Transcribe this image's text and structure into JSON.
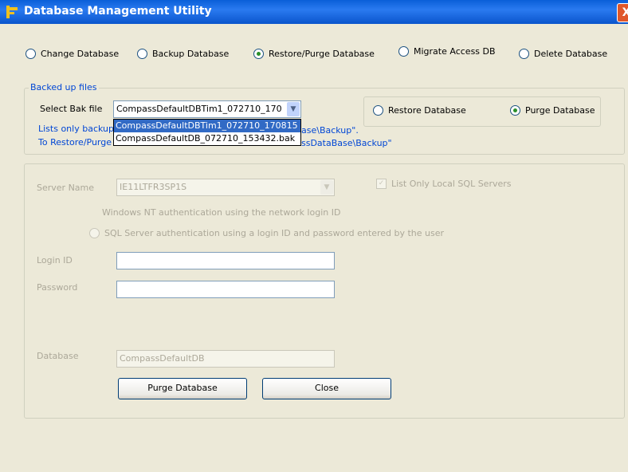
{
  "window": {
    "title": "Database Management Utility",
    "close": "X"
  },
  "modes": [
    {
      "label": "Change Database",
      "selected": false
    },
    {
      "label": "Backup Database",
      "selected": false
    },
    {
      "label": "Restore/Purge Database",
      "selected": true
    },
    {
      "label": "Migrate Access DB",
      "selected": false
    },
    {
      "label": "Delete Database",
      "selected": false
    }
  ],
  "backup_group": {
    "legend": "Backed up files",
    "select_label": "Select Bak file",
    "selected_file": "CompassDefaultDBTim1_072710_170",
    "dropdown_options": [
      "CompassDefaultDBTim1_072710_170815",
      "CompassDefaultDB_072710_153432.bak"
    ],
    "restore_label": "Restore Database",
    "purge_label": "Purge Database",
    "info_line1_start": "Lists only backup",
    "info_line1_end": "ase\\Backup\".",
    "info_line2_start": "To Restore/Purge",
    "info_line2_end": "ssDataBase\\Backup\""
  },
  "server": {
    "server_name_label": "Server Name",
    "server_name_value": "IE11LTFR3SP1S",
    "list_local_label": "List Only Local SQL Servers",
    "nt_auth_label": "Windows NT authentication using the network login ID",
    "sql_auth_label": "SQL Server authentication using a login ID and password entered by the user",
    "login_label": "Login ID",
    "password_label": "Password",
    "database_label": "Database",
    "database_value": "CompassDefaultDB"
  },
  "buttons": {
    "purge": "Purge Database",
    "close": "Close"
  },
  "colors": {
    "title_bar": "#0a5fd8",
    "link_text": "#0046d5",
    "selection": "#316ac5"
  }
}
